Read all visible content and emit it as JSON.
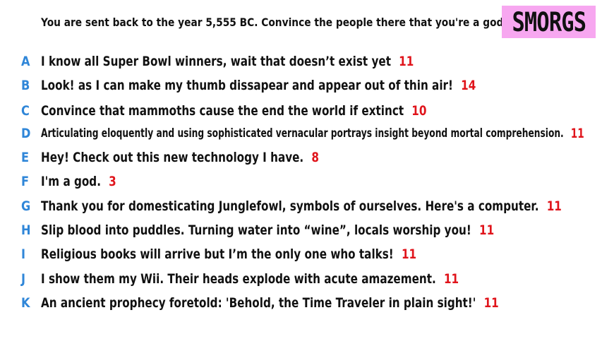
{
  "prompt": "You are sent back to the year 5,555 BC. Convince the people there that you're a god.",
  "logo": "SMORGS",
  "answers": [
    {
      "letter": "A",
      "text": "I know all Super Bowl winners, wait that doesn’t exist yet",
      "score": "11"
    },
    {
      "letter": "B",
      "text": "Look! as I can make my thumb dissapear and appear out of thin air!",
      "score": "14"
    },
    {
      "letter": "C",
      "text": "Convince that mammoths cause the end the world if extinct",
      "score": "10"
    },
    {
      "letter": "D",
      "text": "Articulating eloquently and using sophisticated vernacular portrays insight beyond mortal comprehension.",
      "score": "11"
    },
    {
      "letter": "E",
      "text": "Hey! Check out this new technology I have.",
      "score": "8"
    },
    {
      "letter": "F",
      "text": "I'm a god.",
      "score": "3"
    },
    {
      "letter": "G",
      "text": "Thank you for domesticating Junglefowl, symbols of ourselves. Here's a computer.",
      "score": "11"
    },
    {
      "letter": "H",
      "text": "Slip blood into puddles. Turning water into “wine”, locals worship you!",
      "score": "11"
    },
    {
      "letter": "I",
      "text": "Religious books will arrive but I’m the only one who talks!",
      "score": "11"
    },
    {
      "letter": "J",
      "text": "I show them my Wii. Their heads explode with acute amazement.",
      "score": "11"
    },
    {
      "letter": "K",
      "text": "An ancient prophecy foretold: 'Behold, the Time Traveler in plain sight!'",
      "score": "11"
    }
  ],
  "colors": {
    "letter": "#2f86d8",
    "score": "#e0141b",
    "logo_bg": "#f7a7f0"
  }
}
